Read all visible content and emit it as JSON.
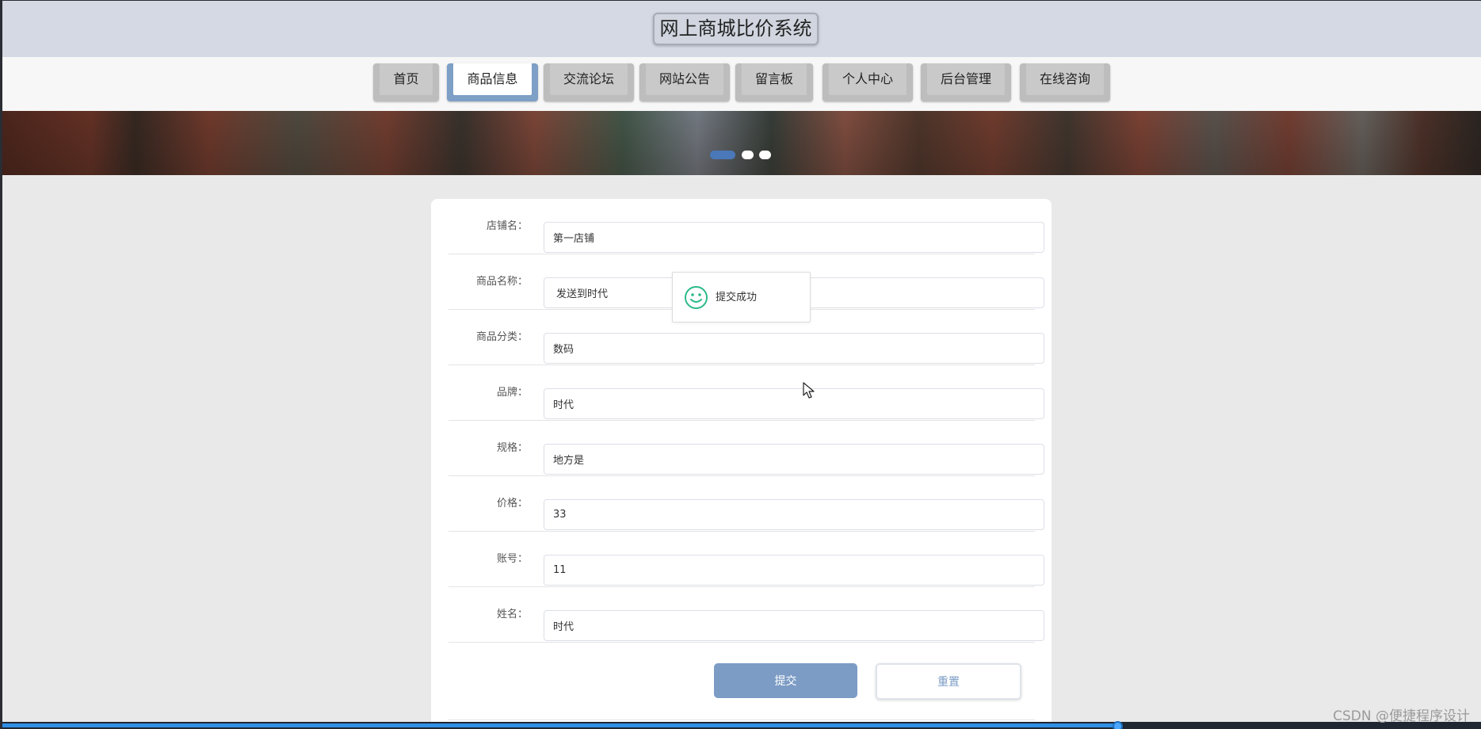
{
  "header": {
    "title": "网上商城比价系统"
  },
  "nav": {
    "items": [
      {
        "label": "首页",
        "active": false
      },
      {
        "label": "商品信息",
        "active": true
      },
      {
        "label": "交流论坛",
        "active": false
      },
      {
        "label": "网站公告",
        "active": false
      },
      {
        "label": "留言板",
        "active": false
      },
      {
        "label": "个人中心",
        "active": false
      },
      {
        "label": "后台管理",
        "active": false
      },
      {
        "label": "在线咨询",
        "active": false
      }
    ]
  },
  "banner": {
    "slide_count": 3,
    "active_slide": 1
  },
  "form": {
    "fields": [
      {
        "label": "店铺名：",
        "value": "第一店铺"
      },
      {
        "label": "商品名称：",
        "value": "发送到时代"
      },
      {
        "label": "商品分类：",
        "value": "数码"
      },
      {
        "label": "品牌：",
        "value": "时代"
      },
      {
        "label": "规格：",
        "value": "地方是"
      },
      {
        "label": "价格：",
        "value": "33"
      },
      {
        "label": "账号：",
        "value": "11"
      },
      {
        "label": "姓名：",
        "value": "时代"
      }
    ],
    "submit_label": "提交",
    "reset_label": "重置"
  },
  "toast": {
    "message": "提交成功"
  },
  "video": {
    "progress_fraction": 0.755
  },
  "watermark": "CSDN @便捷程序设计",
  "colors": {
    "accent": "#7c9cc5",
    "header_bg": "#d4d9e3",
    "success_icon": "#2bb98a",
    "progress": "#2f8fe6"
  }
}
